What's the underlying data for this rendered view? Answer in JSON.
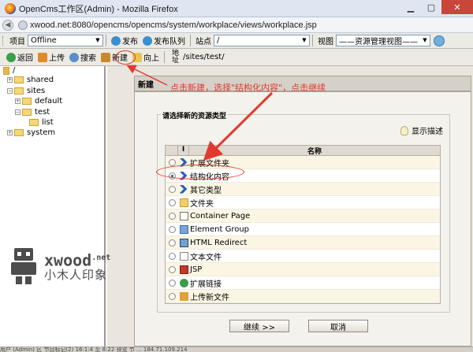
{
  "window": {
    "title": "OpenCms工作区(Admin) - Mozilla Firefox",
    "url": "xwood.net:8080/opencms/opencms/system/workplace/views/workplace.jsp"
  },
  "toolbar": {
    "project_label": "项目",
    "project_value": "Offline",
    "publish_label": "发布",
    "publish_queue_label": "发布队列",
    "site_label": "站点",
    "site_value": "/",
    "view_label": "视图",
    "view_value": "——资源管理视图——"
  },
  "actions": {
    "back": "返回",
    "upload": "上传",
    "search": "搜索",
    "new": "新建",
    "up": "向上",
    "address_label": "地址",
    "address_value": "/sites/test/"
  },
  "tree": {
    "root": "/",
    "items": [
      "shared",
      "sites",
      "default",
      "test",
      "list",
      "system"
    ]
  },
  "dialog": {
    "title": "新建",
    "legend": "请选择新的资源类型",
    "show_desc": "显示描述",
    "col_i": "I",
    "col_name": "名称",
    "rows": [
      {
        "name": "扩展文件夹",
        "icon": "folder-ext-icon"
      },
      {
        "name": "结构化内容",
        "icon": "structured-content-icon",
        "selected": true
      },
      {
        "name": "其它类型",
        "icon": "other-type-icon"
      },
      {
        "name": "文件夹",
        "icon": "folder-icon"
      },
      {
        "name": "Container Page",
        "icon": "container-page-icon"
      },
      {
        "name": "Element Group",
        "icon": "element-group-icon"
      },
      {
        "name": "HTML Redirect",
        "icon": "html-redirect-icon"
      },
      {
        "name": "文本文件",
        "icon": "text-file-icon"
      },
      {
        "name": "JSP",
        "icon": "jsp-icon"
      },
      {
        "name": "扩展链接",
        "icon": "ext-link-icon"
      },
      {
        "name": "上传新文件",
        "icon": "upload-file-icon"
      }
    ],
    "continue_label": "继续 >>",
    "cancel_label": "取消"
  },
  "annotation": {
    "text": "点击新建，选择\"结构化内容\"，点击继续",
    "color": "#e03a2e"
  },
  "watermark": {
    "brand": "xwood",
    "suffix": ".net",
    "tagline": "小木人印象"
  },
  "status": "用户 (Admin) 区 节目标记(2) 16:1:4 至 8:22 预览 节 ... 184.71.109.214"
}
